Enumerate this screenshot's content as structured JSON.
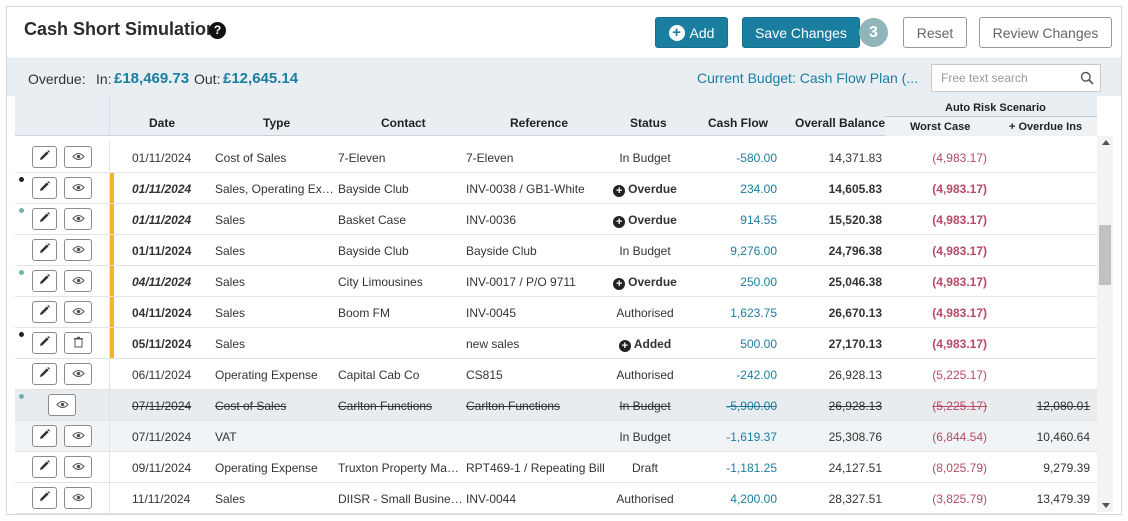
{
  "title": "Cash Short Simulation",
  "toolbar": {
    "add_label": "Add",
    "save_label": "Save Changes",
    "changes_count": "3",
    "reset_label": "Reset",
    "review_label": "Review Changes"
  },
  "summary": {
    "overdue_label": "Overdue:",
    "in_label": "In:",
    "in_amount": "£18,469.73",
    "out_label": "Out:",
    "out_amount": "£12,645.14",
    "budget_link": "Current Budget: Cash Flow Plan (...",
    "search_placeholder": "Free text search"
  },
  "columns": {
    "date": "Date",
    "type": "Type",
    "contact": "Contact",
    "reference": "Reference",
    "status": "Status",
    "cash_flow": "Cash Flow",
    "overall_balance": "Overall Balance",
    "auto_risk": "Auto Risk Scenario",
    "worst_case": "Worst Case",
    "overdue_ins": "+ Overdue Ins"
  },
  "colors": {
    "accent": "#1a7ea1",
    "negative": "#b64a64",
    "flag": "#f3b32a",
    "badge": "#8fb4b9"
  },
  "rows": [
    {
      "date": "01/11/2024",
      "type": "Cost of Sales",
      "contact": "7-Eleven",
      "reference": "7-Eleven",
      "status": "In Budget",
      "status_icon": "",
      "cash_flow": "-580.00",
      "balance": "14,371.83",
      "worst": "(4,983.17)",
      "overdue_ins": "",
      "controls": "edit-view",
      "dot": "",
      "flag": false,
      "bold": false,
      "italic": false,
      "strike": false,
      "bg": ""
    },
    {
      "date": "01/11/2024",
      "type": "Sales, Operating Expense",
      "contact": "Bayside Club",
      "reference": "INV-0038 / GB1-White",
      "status": "Overdue",
      "status_icon": "plus",
      "cash_flow": "234.00",
      "balance": "14,605.83",
      "worst": "(4,983.17)",
      "overdue_ins": "",
      "controls": "edit-view",
      "dot": "#222222",
      "flag": true,
      "bold": true,
      "italic": true,
      "strike": false,
      "bg": ""
    },
    {
      "date": "01/11/2024",
      "type": "Sales",
      "contact": "Basket Case",
      "reference": "INV-0036",
      "status": "Overdue",
      "status_icon": "plus",
      "cash_flow": "914.55",
      "balance": "15,520.38",
      "worst": "(4,983.17)",
      "overdue_ins": "",
      "controls": "edit-view",
      "dot": "#6fb3b3",
      "flag": true,
      "bold": true,
      "italic": true,
      "strike": false,
      "bg": ""
    },
    {
      "date": "01/11/2024",
      "type": "Sales",
      "contact": "Bayside Club",
      "reference": "Bayside Club",
      "status": "In Budget",
      "status_icon": "",
      "cash_flow": "9,276.00",
      "balance": "24,796.38",
      "worst": "(4,983.17)",
      "overdue_ins": "",
      "controls": "edit-view",
      "dot": "",
      "flag": true,
      "bold": true,
      "italic": false,
      "strike": false,
      "bg": ""
    },
    {
      "date": "04/11/2024",
      "type": "Sales",
      "contact": "City Limousines",
      "reference": "INV-0017 / P/O 9711",
      "status": "Overdue",
      "status_icon": "plus",
      "cash_flow": "250.00",
      "balance": "25,046.38",
      "worst": "(4,983.17)",
      "overdue_ins": "",
      "controls": "edit-view",
      "dot": "#6fb3b3",
      "flag": true,
      "bold": true,
      "italic": true,
      "strike": false,
      "bg": ""
    },
    {
      "date": "04/11/2024",
      "type": "Sales",
      "contact": "Boom FM",
      "reference": "INV-0045",
      "status": "Authorised",
      "status_icon": "",
      "cash_flow": "1,623.75",
      "balance": "26,670.13",
      "worst": "(4,983.17)",
      "overdue_ins": "",
      "controls": "edit-view",
      "dot": "",
      "flag": true,
      "bold": true,
      "italic": false,
      "strike": false,
      "bg": ""
    },
    {
      "date": "05/11/2024",
      "type": "Sales",
      "contact": "",
      "reference": "new sales",
      "status": "Added",
      "status_icon": "plus",
      "cash_flow": "500.00",
      "balance": "27,170.13",
      "worst": "(4,983.17)",
      "overdue_ins": "",
      "controls": "edit-delete",
      "dot": "#222222",
      "flag": true,
      "bold": true,
      "italic": false,
      "strike": false,
      "bg": ""
    },
    {
      "date": "06/11/2024",
      "type": "Operating Expense",
      "contact": "Capital Cab Co",
      "reference": "CS815",
      "status": "Authorised",
      "status_icon": "",
      "cash_flow": "-242.00",
      "balance": "26,928.13",
      "worst": "(5,225.17)",
      "overdue_ins": "",
      "controls": "edit-view",
      "dot": "",
      "flag": false,
      "bold": false,
      "italic": false,
      "strike": false,
      "bg": ""
    },
    {
      "date": "07/11/2024",
      "type": "Cost of Sales",
      "contact": "Carlton Functions",
      "reference": "Carlton Functions",
      "status": "In Budget",
      "status_icon": "",
      "cash_flow": "-5,900.00",
      "balance": "26,928.13",
      "worst": "(5,225.17)",
      "overdue_ins": "12,080.01",
      "controls": "view-only",
      "dot": "#6fb3b3",
      "flag": false,
      "bold": false,
      "italic": false,
      "strike": true,
      "bg": "removed"
    },
    {
      "date": "07/11/2024",
      "type": "VAT",
      "contact": "",
      "reference": "",
      "status": "In Budget",
      "status_icon": "",
      "cash_flow": "-1,619.37",
      "balance": "25,308.76",
      "worst": "(6,844.54)",
      "overdue_ins": "10,460.64",
      "controls": "edit-view",
      "dot": "",
      "flag": false,
      "bold": false,
      "italic": false,
      "strike": false,
      "bg": "highlight"
    },
    {
      "date": "09/11/2024",
      "type": "Operating Expense",
      "contact": "Truxton Property Management",
      "reference": "RPT469-1 / Repeating Bill",
      "status": "Draft",
      "status_icon": "",
      "cash_flow": "-1,181.25",
      "balance": "24,127.51",
      "worst": "(8,025.79)",
      "overdue_ins": "9,279.39",
      "controls": "edit-view",
      "dot": "",
      "flag": false,
      "bold": false,
      "italic": false,
      "strike": false,
      "bg": ""
    },
    {
      "date": "11/11/2024",
      "type": "Sales",
      "contact": "DIISR - Small Business Services",
      "reference": "INV-0044",
      "status": "Authorised",
      "status_icon": "",
      "cash_flow": "4,200.00",
      "balance": "28,327.51",
      "worst": "(3,825.79)",
      "overdue_ins": "13,479.39",
      "controls": "edit-view",
      "dot": "",
      "flag": false,
      "bold": false,
      "italic": false,
      "strike": false,
      "bg": ""
    }
  ]
}
